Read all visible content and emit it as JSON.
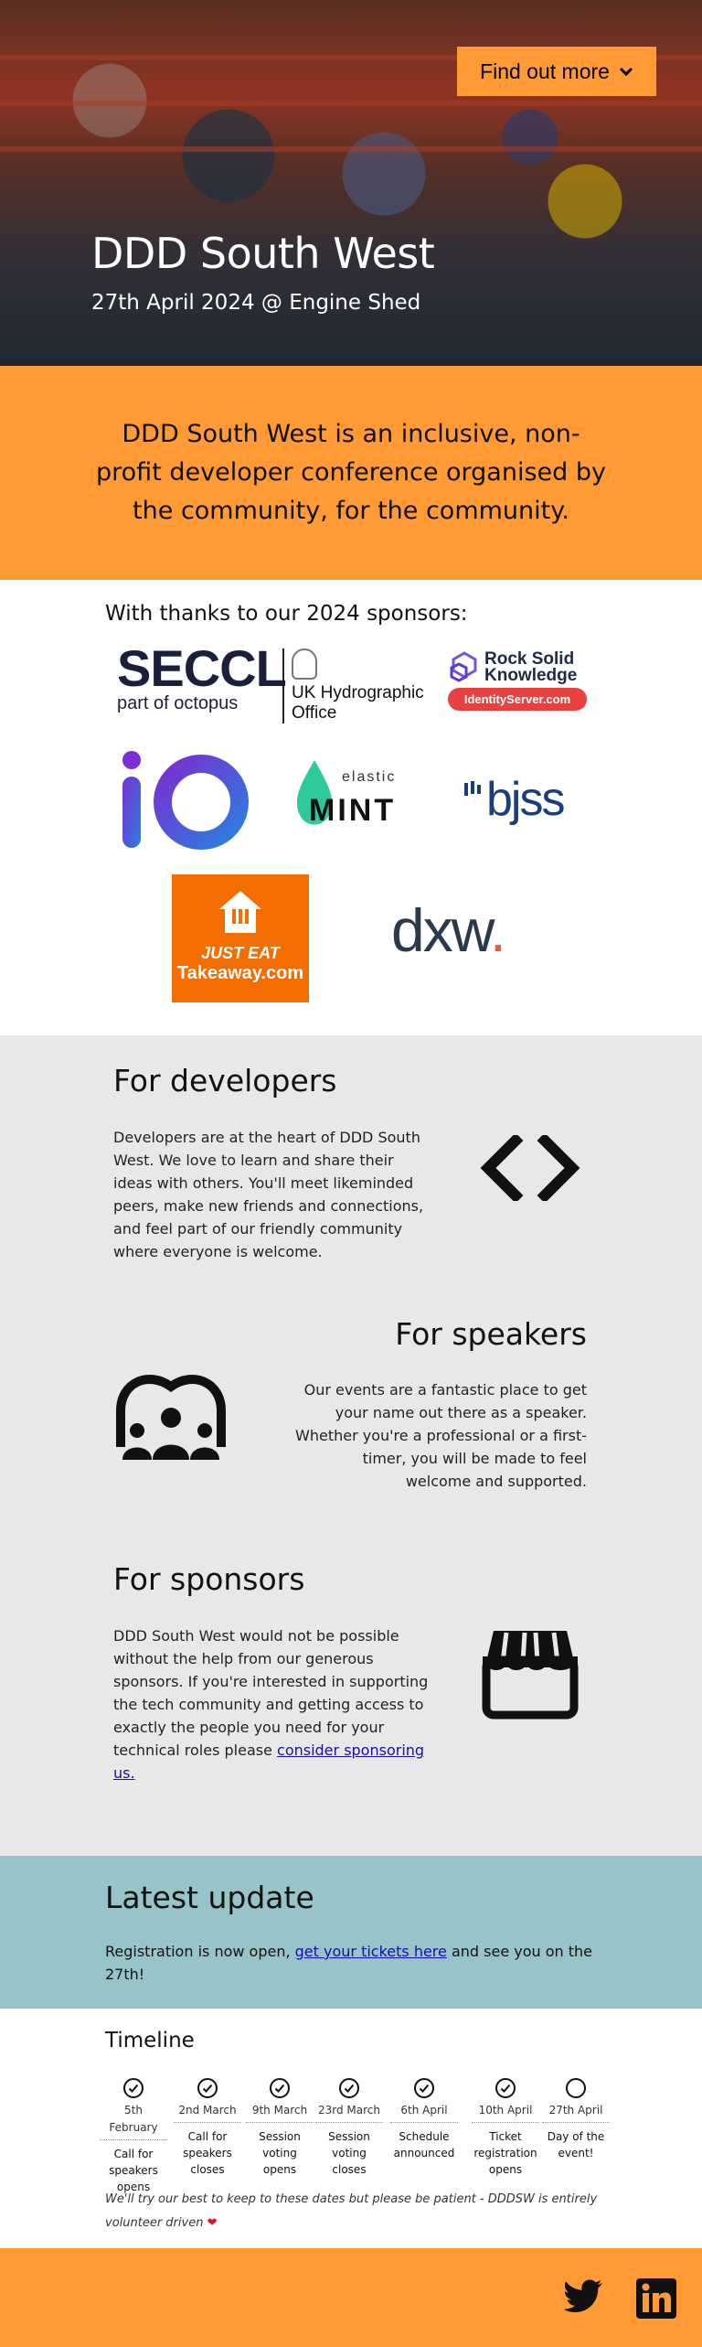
{
  "hero": {
    "cta_label": "Find out more",
    "title": "DDD South West",
    "subtitle": "27th April 2024 @ Engine Shed"
  },
  "intro": {
    "text": "DDD South West is an inclusive, non-profit developer conference organised by the community, for the community."
  },
  "sponsors": {
    "heading": "With thanks to our 2024 sponsors:",
    "seccl_name": "SECCL",
    "seccl_tag": "part of octopus",
    "ukho_line1": "UK Hydrographic",
    "ukho_line2": "Office",
    "rsk_line1": "Rock Solid",
    "rsk_line2": "Knowledge",
    "rsk_pill": "IdentityServer.com",
    "mint_top": "elastic",
    "mint_name": "MINT",
    "bjss_name": "bjss",
    "justeat_line1": "JUST EAT",
    "justeat_line2": "Takeaway.com",
    "dxw_name": "dxw"
  },
  "sections": {
    "developers": {
      "title": "For developers",
      "text": "Developers are at the heart of DDD South West. We love to learn and share their ideas with others. You'll meet likeminded peers, make new friends and connections, and feel part of our friendly community where everyone is welcome.",
      "icon": "code-icon"
    },
    "speakers": {
      "title": "For speakers",
      "text": "Our events are a fantastic place to get your name out there as a speaker. Whether you're a professional or a first-timer, you will be made to feel welcome and supported.",
      "icon": "audience-icon"
    },
    "sponsors": {
      "title": "For sponsors",
      "text_before": "DDD South West would not be possible without the help from our generous sponsors. If you're interested in supporting the tech community and getting access to exactly the people you need for your technical roles please ",
      "link": "consider sponsoring us.",
      "icon": "store-icon"
    }
  },
  "latest": {
    "title": "Latest update",
    "text_before": "Registration is now open, ",
    "link": "get your tickets here",
    "text_after": " and see you on the 27th!"
  },
  "timeline": {
    "title": "Timeline",
    "items": [
      {
        "date": "5th February",
        "label": "Call for speakers opens",
        "done": true
      },
      {
        "date": "2nd March",
        "label": "Call for speakers closes",
        "done": true
      },
      {
        "date": "9th March",
        "label": "Session voting opens",
        "done": true
      },
      {
        "date": "23rd March",
        "label": "Session voting closes",
        "done": true
      },
      {
        "date": "6th April",
        "label": "Schedule announced",
        "done": true
      },
      {
        "date": "10th April",
        "label": "Ticket registration opens",
        "done": true
      },
      {
        "date": "27th April",
        "label": "Day of the event!",
        "done": false
      }
    ],
    "note": "We'll try our best to keep to these dates but please be patient - DDDSW is entirely volunteer driven"
  },
  "footer": {
    "twitter_icon": "twitter-icon",
    "linkedin_icon": "linkedin-icon"
  },
  "colors": {
    "orange": "#ff9a35",
    "gray": "#e8e8e8",
    "teal": "#96c4c8"
  }
}
